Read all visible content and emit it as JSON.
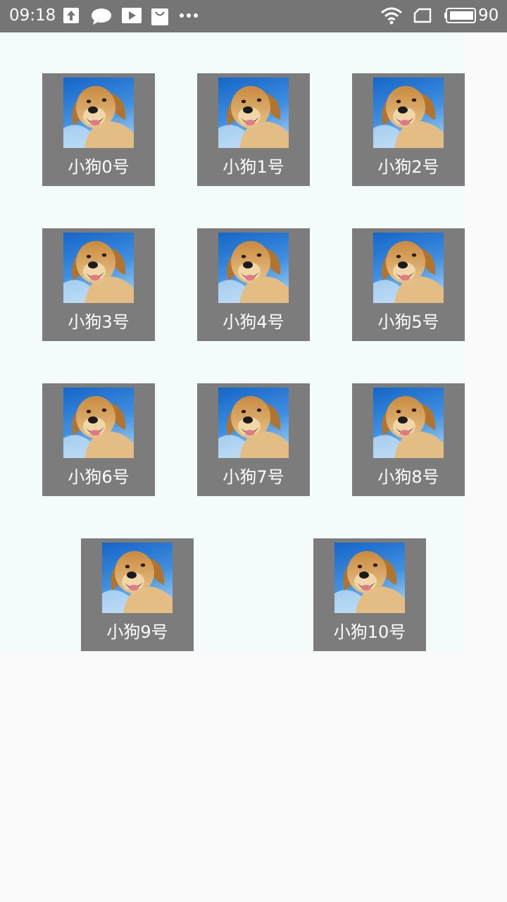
{
  "status_bar": {
    "time": "09:18",
    "battery_level": "90",
    "icons": [
      "upload-icon",
      "chat-bubble-icon",
      "play-icon",
      "shopping-bag-icon",
      "more-dots-icon",
      "wifi-icon",
      "sim-card-icon",
      "battery-icon"
    ]
  },
  "colors": {
    "status_bar_bg": "#757575",
    "content_bg": "#f3fbfb",
    "card_bg": "#7c7c7c",
    "label_text": "#ffffff"
  },
  "dogs": [
    {
      "label": "小狗0号"
    },
    {
      "label": "小狗1号"
    },
    {
      "label": "小狗2号"
    },
    {
      "label": "小狗3号"
    },
    {
      "label": "小狗4号"
    },
    {
      "label": "小狗5号"
    },
    {
      "label": "小狗6号"
    },
    {
      "label": "小狗7号"
    },
    {
      "label": "小狗8号"
    },
    {
      "label": "小狗9号"
    },
    {
      "label": "小狗10号"
    }
  ]
}
